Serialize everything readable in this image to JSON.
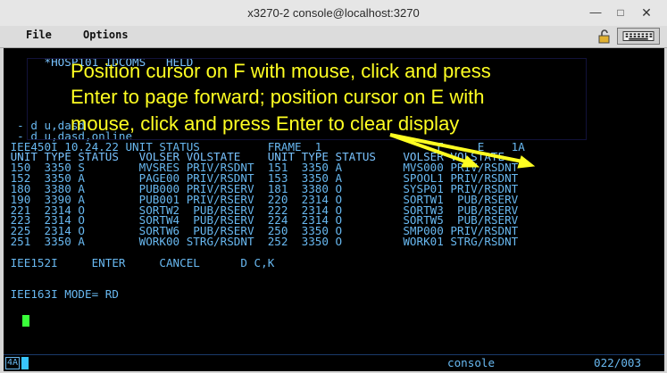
{
  "window": {
    "title": "x3270-2 console@localhost:3270"
  },
  "menu": {
    "file": "File",
    "options": "Options"
  },
  "terminal": {
    "lines": [
      {
        "text": "      *HOSP101 IDCOMS   HELD",
        "cls": "hdr"
      },
      {
        "text": "",
        "cls": ""
      },
      {
        "text": "",
        "cls": ""
      },
      {
        "text": "",
        "cls": ""
      },
      {
        "text": "",
        "cls": ""
      },
      {
        "text": "",
        "cls": ""
      },
      {
        "text": "  - d u,dasd",
        "cls": ""
      },
      {
        "text": "  - d u,dasd,online",
        "cls": ""
      },
      {
        "text": " IEE450I 10.24.22 UNIT STATUS          FRAME  1                 F     E    1A",
        "cls": ""
      },
      {
        "text": " UNIT TYPE STATUS   VOLSER VOLSTATE    UNIT TYPE STATUS    VOLSER VOLSTATE",
        "cls": "hdr"
      },
      {
        "text": " 150  3350 S        MVSRES PRIV/RSDNT  151  3350 A         MVS000 PRIV/RSDNT",
        "cls": ""
      },
      {
        "text": " 152  3350 A        PAGE00 PRIV/RSDNT  153  3350 A         SPOOL1 PRIV/RSDNT",
        "cls": ""
      },
      {
        "text": " 180  3380 A        PUB000 PRIV/RSERV  181  3380 O         SYSP01 PRIV/RSDNT",
        "cls": ""
      },
      {
        "text": " 190  3390 A        PUB001 PRIV/RSERV  220  2314 O         SORTW1  PUB/RSERV",
        "cls": ""
      },
      {
        "text": " 221  2314 O        SORTW2  PUB/RSERV  222  2314 O         SORTW3  PUB/RSERV",
        "cls": ""
      },
      {
        "text": " 223  2314 O        SORTW4  PUB/RSERV  224  2314 O         SORTW5  PUB/RSERV",
        "cls": ""
      },
      {
        "text": " 225  2314 O        SORTW6  PUB/RSERV  250  3350 O         SMP000 PRIV/RSDNT",
        "cls": ""
      },
      {
        "text": " 251  3350 A        WORK00 STRG/RSDNT  252  3350 O         WORK01 STRG/RSDNT",
        "cls": ""
      },
      {
        "text": "",
        "cls": ""
      },
      {
        "text": " IEE152I     ENTER     CANCEL      D C,K",
        "cls": ""
      },
      {
        "text": "",
        "cls": ""
      },
      {
        "text": "",
        "cls": ""
      },
      {
        "text": " IEE163I MODE= RD",
        "cls": ""
      }
    ]
  },
  "annotation": {
    "line1": "Position cursor on F with mouse, click and press",
    "line2": "Enter to page forward; position cursor on E with",
    "line3": "mouse, click and press Enter to clear display"
  },
  "status": {
    "indicator": "4A",
    "session": "console",
    "cursor_pos": "022/003"
  },
  "colors": {
    "terminal_bg": "#000000",
    "text": "#68b8f0",
    "annotation": "#ffff22",
    "cursor": "#39ff39"
  }
}
